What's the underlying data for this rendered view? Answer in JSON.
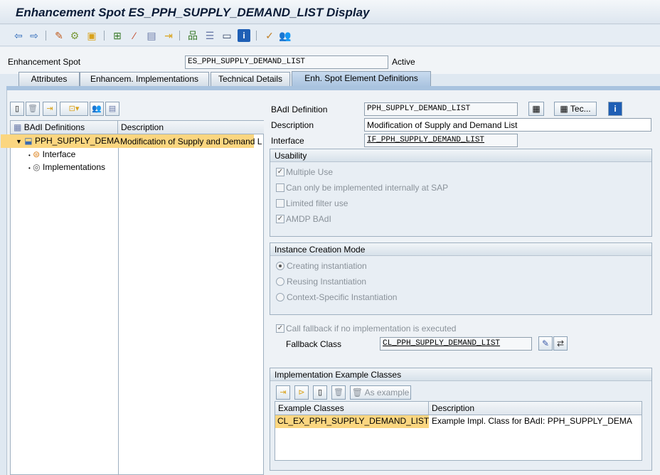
{
  "window": {
    "title": "Enhancement Spot ES_PPH_SUPPLY_DEMAND_LIST Display"
  },
  "toolbar": {
    "icons": [
      "back-icon",
      "forward-icon",
      "display-change-icon",
      "other-object-icon",
      "activate-icon",
      "where-used-icon",
      "display-object-list-icon",
      "enhancement-info-icon",
      "navigation-icon",
      "hierarchy-icon",
      "outline-icon",
      "layout-icon",
      "info-icon",
      "check-icon",
      "users-icon"
    ]
  },
  "header": {
    "spot_label": "Enhancement Spot",
    "spot_value": "ES_PPH_SUPPLY_DEMAND_LIST",
    "status": "Active"
  },
  "tabs": [
    {
      "label": "Attributes"
    },
    {
      "label": "Enhancem. Implementations"
    },
    {
      "label": "Technical Details"
    },
    {
      "label": "Enh. Spot Element Definitions"
    }
  ],
  "tree": {
    "columns": [
      "BAdI Definitions",
      "Description"
    ],
    "root": {
      "name": "PPH_SUPPLY_DEMA",
      "description": "Modification of Supply and Demand L"
    },
    "children": [
      {
        "label": "Interface"
      },
      {
        "label": "Implementations"
      }
    ]
  },
  "detail": {
    "badi_label": "BAdI Definition",
    "badi_value": "PPH_SUPPLY_DEMAND_LIST",
    "tec_button": "Tec...",
    "desc_label": "Description",
    "desc_value": "Modification of Supply and Demand List",
    "iface_label": "Interface",
    "iface_value": "IF_PPH_SUPPLY_DEMAND_LIST"
  },
  "usability": {
    "title": "Usability",
    "options": [
      {
        "label": "Multiple Use",
        "checked": true
      },
      {
        "label": "Can only be implemented internally at SAP",
        "checked": false
      },
      {
        "label": "Limited filter use",
        "checked": false
      },
      {
        "label": "AMDP BAdI",
        "checked": true
      }
    ]
  },
  "instance": {
    "title": "Instance Creation Mode",
    "options": [
      {
        "label": "Creating instantiation",
        "selected": true
      },
      {
        "label": "Reusing Instantiation",
        "selected": false
      },
      {
        "label": "Context-Specific Instantiation",
        "selected": false
      }
    ]
  },
  "fallback": {
    "checkbox_label": "Call fallback if no implementation is executed",
    "class_label": "Fallback Class",
    "class_value": "CL_PPH_SUPPLY_DEMAND_LIST"
  },
  "examples": {
    "title": "Implementation Example Classes",
    "as_example": "As example",
    "columns": [
      "Example Classes",
      "Description"
    ],
    "rows": [
      {
        "cls": "CL_EX_PPH_SUPPLY_DEMAND_LIST",
        "desc": "Example Impl. Class for BAdI: PPH_SUPPLY_DEMA..."
      }
    ]
  },
  "colors": {
    "selection": "#fbd680",
    "tab_active": "#a9c3df",
    "title_text": "#0c1d38"
  }
}
